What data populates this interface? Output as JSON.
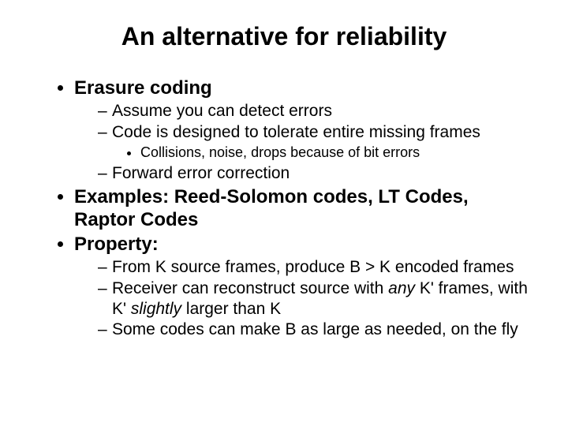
{
  "title": "An alternative for reliability",
  "b1": {
    "text": "Erasure coding",
    "s1": "Assume you can detect errors",
    "s2": "Code is designed to tolerate entire missing frames",
    "s2a": "Collisions, noise, drops because of bit errors",
    "s3": "Forward error correction"
  },
  "b2": {
    "text": "Examples: Reed-Solomon codes, LT Codes, Raptor Codes"
  },
  "b3": {
    "text": "Property:",
    "s1": "From K source frames, produce B > K encoded frames",
    "s2a": "Receiver can reconstruct source with ",
    "s2b": "any",
    "s2c": " K' frames, with K' ",
    "s2d": "slightly",
    "s2e": " larger than K",
    "s3": "Some codes can make B as large as needed, on the fly"
  }
}
